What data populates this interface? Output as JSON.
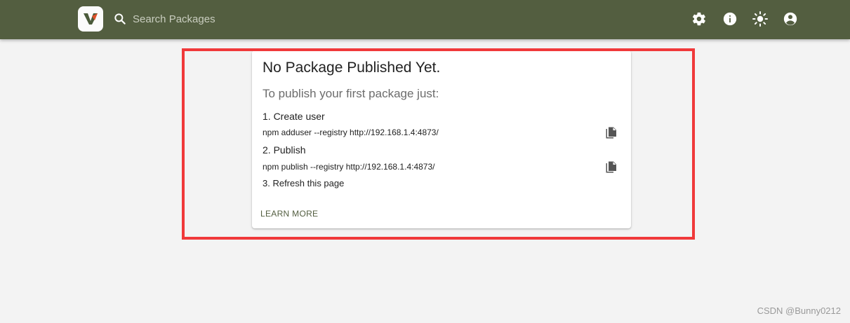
{
  "header": {
    "logo_letter": "V",
    "search": {
      "placeholder": "Search Packages",
      "value": ""
    },
    "icons": [
      "gear-icon",
      "info-icon",
      "brightness-icon",
      "account-icon"
    ]
  },
  "card": {
    "title": "No Package Published Yet.",
    "subtitle": "To publish your first package just:",
    "steps": [
      {
        "label": "1. Create user",
        "command": "npm adduser --registry http://192.168.1.4:4873/"
      },
      {
        "label": "2. Publish",
        "command": "npm publish --registry http://192.168.1.4:4873/"
      },
      {
        "label": "3. Refresh this page"
      }
    ],
    "learn_more": "LEARN MORE"
  },
  "watermark": "CSDN @Bunny0212",
  "colors": {
    "appbar": "#535e40",
    "highlight_border": "#f0393a",
    "background": "#f3f3f3"
  }
}
